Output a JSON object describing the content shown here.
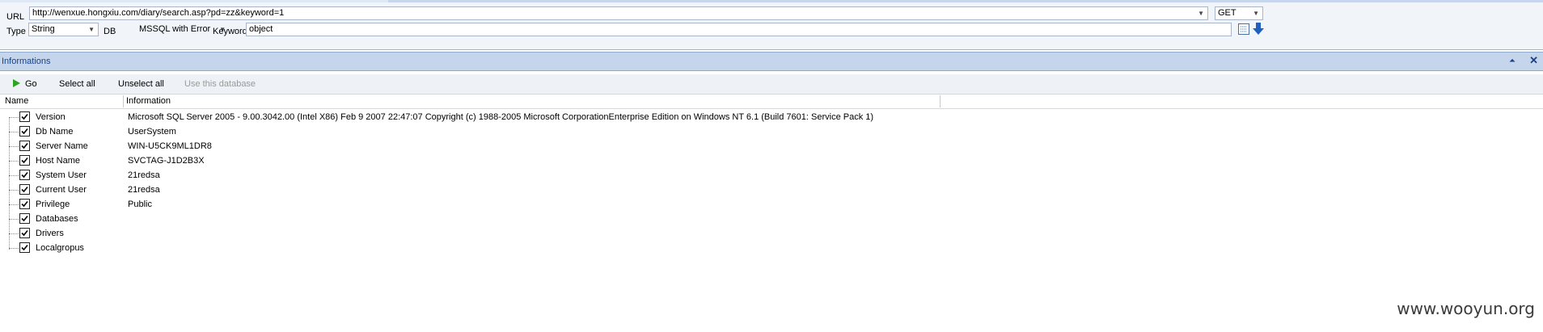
{
  "toolbar": {
    "url_label": "URL",
    "url_value": "http://wenxue.hongxiu.com/diary/search.asp?pd=zz&keyword=1",
    "method_value": "GET",
    "type_label": "Type",
    "type_value": "String",
    "db_label": "DB",
    "db_value": "MSSQL with Error",
    "keyword_label": "Keyword",
    "keyword_value": "object"
  },
  "panel": {
    "title": "Informations"
  },
  "commands": {
    "go": "Go",
    "select_all": "Select all",
    "unselect_all": "Unselect all",
    "use_database": "Use this database"
  },
  "columns": {
    "name": "Name",
    "information": "Information"
  },
  "rows": [
    {
      "name": "Version",
      "info": "Microsoft SQL Server 2005 - 9.00.3042.00 (Intel X86) Feb  9 2007 22:47:07 Copyright (c) 1988-2005 Microsoft CorporationEnterprise Edition on Windows NT 6.1 (Build 7601: Service Pack 1)",
      "checked": true
    },
    {
      "name": "Db Name",
      "info": "UserSystem",
      "checked": true
    },
    {
      "name": "Server Name",
      "info": "WIN-U5CK9ML1DR8",
      "checked": true
    },
    {
      "name": "Host Name",
      "info": "SVCTAG-J1D2B3X",
      "checked": true
    },
    {
      "name": "System User",
      "info": "21redsa",
      "checked": true
    },
    {
      "name": "Current User",
      "info": "21redsa",
      "checked": true
    },
    {
      "name": "Privilege",
      "info": "Public",
      "checked": true
    },
    {
      "name": "Databases",
      "info": "",
      "checked": true
    },
    {
      "name": "Drivers",
      "info": "",
      "checked": true
    },
    {
      "name": "Localgropus",
      "info": "",
      "checked": true
    }
  ],
  "watermark": "www.wooyun.org"
}
